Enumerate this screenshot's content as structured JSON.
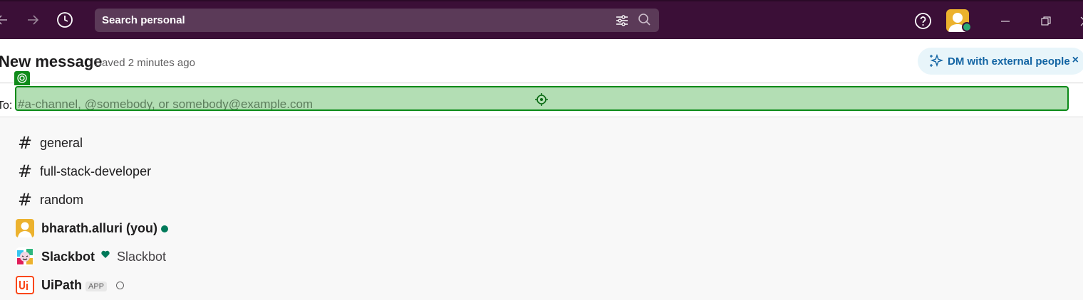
{
  "topbar": {
    "search_label": "Search personal",
    "icons": [
      "back-arrow-icon",
      "forward-arrow-icon",
      "history-icon",
      "filter-icon",
      "search-icon",
      "help-icon",
      "minimize-icon",
      "restore-icon",
      "close-icon"
    ]
  },
  "header": {
    "title": "New message",
    "saved": "Saved 2 minutes ago",
    "dm_pill_label": "DM with external people",
    "dm_close": "×"
  },
  "to_row": {
    "label": "To:",
    "placeholder": "#a-channel, @somebody, or somebody@example.com"
  },
  "suggestions": [
    {
      "type": "channel",
      "label": "general"
    },
    {
      "type": "channel",
      "label": "full-stack-developer"
    },
    {
      "type": "channel",
      "label": "random"
    },
    {
      "type": "user",
      "label": "bharath.alluri (you)",
      "status": "active"
    },
    {
      "type": "user",
      "label": "Slackbot",
      "sub": "Slackbot"
    },
    {
      "type": "app",
      "label": "UiPath",
      "badge": "APP"
    }
  ],
  "colors": {
    "topbar_bg": "#3b0f37",
    "search_bg": "#5b3a58",
    "highlight_fill": "#b3deb4",
    "highlight_border": "#0b8a18",
    "link": "#1264a3",
    "presence": "#007a5a"
  }
}
